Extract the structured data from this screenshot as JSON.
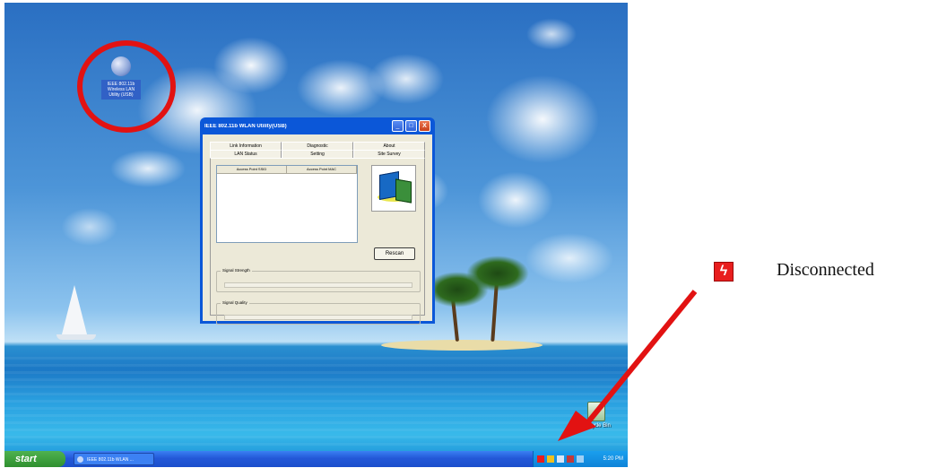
{
  "desktop": {
    "icon_label": "IEEE 802.11b Wireless LAN Utility (USB)",
    "recycle_bin_label": "Recycle Bin"
  },
  "window": {
    "title": "IEEE 802.11b WLAN Utility(USB)",
    "minimize": "_",
    "maximize": "□",
    "close": "X",
    "tabs_row1": [
      "Link Information",
      "Diagnostic",
      "About"
    ],
    "tabs_row2": [
      "LAN Status",
      "Setting",
      "Site Survey"
    ],
    "columns": [
      "Access Point SSID",
      "Access Point MAC"
    ],
    "rescan": "Rescan",
    "signal_strength": "Signal Strength",
    "signal_quality": "Signal Quality"
  },
  "taskbar": {
    "start": "start",
    "task": "IEEE 802.11b WLAN ...",
    "clock": "5:20 PM"
  },
  "annotation": {
    "status_label": "Disconnected"
  },
  "colors": {
    "circle": "#e21212",
    "arrow": "#e21212",
    "xp_blue": "#0b57d8"
  }
}
